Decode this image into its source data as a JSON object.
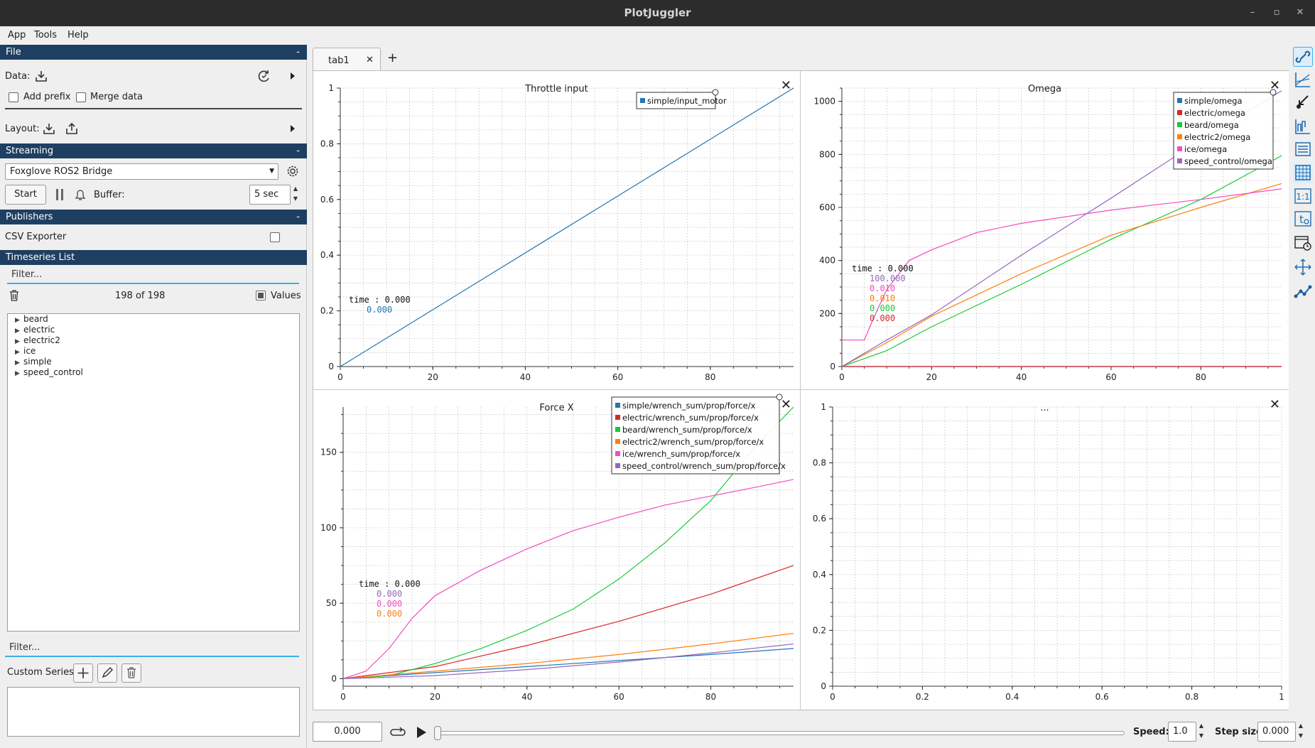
{
  "window": {
    "title": "PlotJuggler",
    "minimize": "–",
    "maximize": "▫",
    "close": "✕"
  },
  "menu": [
    "App",
    "Tools",
    "Help"
  ],
  "file": {
    "header": "File",
    "collapse": "-",
    "data_label": "Data:",
    "add_prefix": "Add prefix",
    "merge_data": "Merge data",
    "layout_label": "Layout:"
  },
  "streaming": {
    "header": "Streaming",
    "collapse": "-",
    "source": "Foxglove ROS2 Bridge",
    "start": "Start",
    "buffer_label": "Buffer:",
    "buffer_value": "5 sec"
  },
  "publishers": {
    "header": "Publishers",
    "collapse": "-",
    "csv_exporter": "CSV Exporter"
  },
  "timeseries": {
    "header": "Timeseries List",
    "filter_placeholder": "Filter...",
    "count": "198 of 198",
    "values_label": "Values",
    "items": [
      "beard",
      "electric",
      "electric2",
      "ice",
      "simple",
      "speed_control"
    ]
  },
  "custom": {
    "filter_placeholder": "Filter...",
    "label": "Custom Series:"
  },
  "tabs": {
    "active": "tab1",
    "close": "✕",
    "add": "+"
  },
  "colors": {
    "simple": "#1f77b4",
    "electric": "#d62728",
    "beard": "#1ac938",
    "electric2": "#ff7f0e",
    "ice": "#f14cc1",
    "speed_control": "#9467bd",
    "header": "#1e3f61",
    "accent": "#3daee9"
  },
  "plot_labels": {
    "p1": {
      "title": "Throttle input",
      "close": "✕",
      "tracker_time": "time : 0.000",
      "tracker_vals": [
        "0.000"
      ]
    },
    "p2": {
      "title": "Omega",
      "close": "✕",
      "tracker_time": "time : 0.000",
      "tracker_vals": [
        "100.000",
        "0.010",
        "0.010",
        "0.000",
        "0.000"
      ]
    },
    "p3": {
      "title": "Force X",
      "close": "✕",
      "tracker_time": "time : 0.000",
      "tracker_vals": [
        "0.000",
        "0.000",
        "0.000"
      ]
    },
    "p4": {
      "title": "...",
      "close": "✕"
    }
  },
  "chart_data": [
    {
      "type": "line",
      "title": "Throttle input",
      "xlim": [
        0,
        98
      ],
      "ylim": [
        0,
        1
      ],
      "xticks": [
        0,
        20,
        40,
        60,
        80
      ],
      "yticks": [
        0,
        0.2,
        0.4,
        0.6,
        0.8,
        1
      ],
      "grid": true,
      "legend_position": "top-right",
      "series": [
        {
          "name": "simple/input_motor",
          "color": "#1f77b4",
          "x": [
            0,
            98
          ],
          "y": [
            0,
            1
          ]
        }
      ]
    },
    {
      "type": "line",
      "title": "Omega",
      "xlim": [
        0,
        98
      ],
      "ylim": [
        0,
        1050
      ],
      "xticks": [
        0,
        20,
        40,
        60,
        80
      ],
      "yticks": [
        0,
        200,
        400,
        600,
        800,
        1000
      ],
      "grid": true,
      "legend_position": "top-right",
      "series": [
        {
          "name": "simple/omega",
          "color": "#1f77b4",
          "x": [
            0,
            98
          ],
          "y": [
            0,
            0
          ]
        },
        {
          "name": "electric/omega",
          "color": "#d62728",
          "x": [
            0,
            98
          ],
          "y": [
            0,
            0
          ]
        },
        {
          "name": "beard/omega",
          "color": "#1ac938",
          "x": [
            0,
            10,
            20,
            40,
            60,
            80,
            98
          ],
          "y": [
            0,
            60,
            150,
            310,
            480,
            630,
            795
          ]
        },
        {
          "name": "electric2/omega",
          "color": "#ff7f0e",
          "x": [
            0,
            10,
            20,
            40,
            60,
            80,
            98
          ],
          "y": [
            0,
            90,
            190,
            350,
            495,
            600,
            690
          ]
        },
        {
          "name": "ice/omega",
          "color": "#f14cc1",
          "x": [
            0,
            5,
            7,
            10,
            15,
            20,
            30,
            40,
            60,
            80,
            98
          ],
          "y": [
            100,
            100,
            180,
            290,
            400,
            440,
            505,
            540,
            590,
            630,
            670
          ]
        },
        {
          "name": "speed_control/omega",
          "color": "#9467bd",
          "x": [
            0,
            10,
            20,
            40,
            60,
            80,
            98
          ],
          "y": [
            0,
            100,
            195,
            420,
            635,
            855,
            1040
          ]
        }
      ]
    },
    {
      "type": "line",
      "title": "Force X",
      "xlim": [
        0,
        98
      ],
      "ylim": [
        -5,
        180
      ],
      "xticks": [
        0,
        20,
        40,
        60,
        80
      ],
      "yticks": [
        0,
        50,
        100,
        150
      ],
      "grid": true,
      "legend_position": "top-right",
      "series": [
        {
          "name": "simple/wrench_sum/prop/force/x",
          "color": "#1f77b4",
          "x": [
            0,
            20,
            40,
            60,
            80,
            98
          ],
          "y": [
            0,
            4,
            8,
            12,
            16,
            20
          ]
        },
        {
          "name": "electric/wrench_sum/prop/force/x",
          "color": "#d62728",
          "x": [
            0,
            20,
            40,
            60,
            80,
            98
          ],
          "y": [
            0,
            8,
            22,
            38,
            56,
            75
          ]
        },
        {
          "name": "beard/wrench_sum/prop/force/x",
          "color": "#1ac938",
          "x": [
            0,
            10,
            20,
            30,
            40,
            50,
            60,
            70,
            80,
            90,
            98
          ],
          "y": [
            0,
            2,
            10,
            20,
            32,
            46,
            66,
            90,
            118,
            155,
            180
          ]
        },
        {
          "name": "electric2/wrench_sum/prop/force/x",
          "color": "#ff7f0e",
          "x": [
            0,
            20,
            40,
            60,
            80,
            98
          ],
          "y": [
            0,
            5,
            10,
            16,
            23,
            30
          ]
        },
        {
          "name": "ice/wrench_sum/prop/force/x",
          "color": "#f14cc1",
          "x": [
            0,
            5,
            10,
            15,
            20,
            30,
            40,
            50,
            60,
            70,
            80,
            90,
            98
          ],
          "y": [
            0,
            5,
            20,
            40,
            55,
            72,
            86,
            98,
            107,
            115,
            121,
            127,
            132
          ]
        },
        {
          "name": "speed_control/wrench_sum/prop/force/x",
          "color": "#9467bd",
          "x": [
            0,
            20,
            40,
            60,
            80,
            98
          ],
          "y": [
            0,
            2,
            6,
            11,
            17,
            23
          ]
        }
      ]
    },
    {
      "type": "line",
      "title": "...",
      "xlim": [
        0,
        1
      ],
      "ylim": [
        0,
        1
      ],
      "xticks": [
        0,
        0.2,
        0.4,
        0.6,
        0.8,
        1
      ],
      "yticks": [
        0,
        0.2,
        0.4,
        0.6,
        0.8,
        1
      ],
      "grid": true,
      "series": []
    }
  ],
  "playback": {
    "time": "0.000",
    "speed_label": "Speed:",
    "speed": "1.0",
    "step_label": "Step size:",
    "step": "0.000"
  },
  "right_toolbar_icons": [
    "link-icon",
    "ratio-icon",
    "pointer-icon",
    "chart-icon",
    "list-icon",
    "grid-icon",
    "one-to-one-icon",
    "t0-icon",
    "clock-icon",
    "move-icon",
    "path-icon"
  ]
}
